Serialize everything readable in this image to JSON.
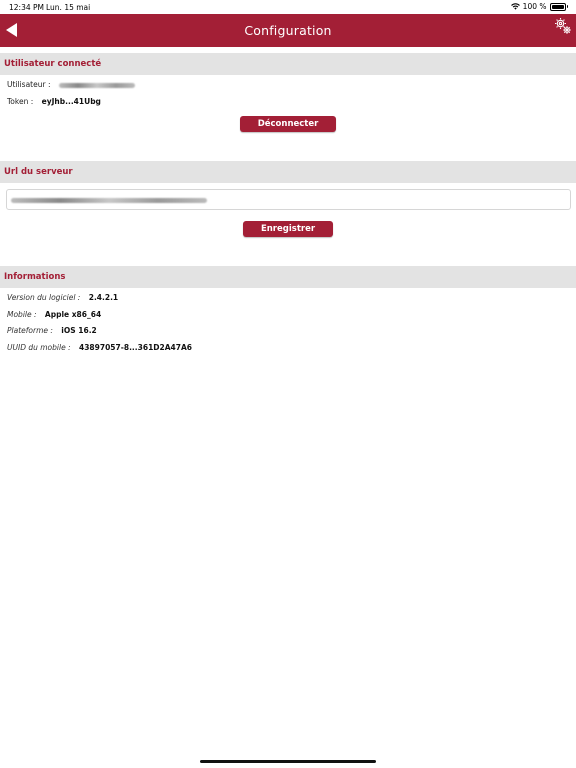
{
  "status_bar": {
    "time": "12:34 PM",
    "date": "Lun. 15 mai",
    "battery": "100 %"
  },
  "nav": {
    "title": "Configuration",
    "back_icon": "back-arrow-icon",
    "settings_icon": "gears-icon"
  },
  "user_section": {
    "header": "Utilisateur connecté",
    "user_label": "Utilisateur :",
    "token_label": "Token :",
    "token_value": "eyJhb...41Ubg",
    "disconnect_label": "Déconnecter"
  },
  "server_section": {
    "header": "Url du serveur",
    "save_label": "Enregistrer"
  },
  "info_section": {
    "header": "Informations",
    "version_label": "Version du logiciel :",
    "version_value": "2.4.2.1",
    "mobile_label": "Mobile :",
    "mobile_value": "Apple x86_64",
    "platform_label": "Plateforme :",
    "platform_value": "iOS 16.2",
    "uuid_label": "UUID du mobile :",
    "uuid_value": "43897057-8...361D2A47A6"
  },
  "colors": {
    "brand": "#a31f36",
    "section_bg": "#e3e3e3"
  }
}
